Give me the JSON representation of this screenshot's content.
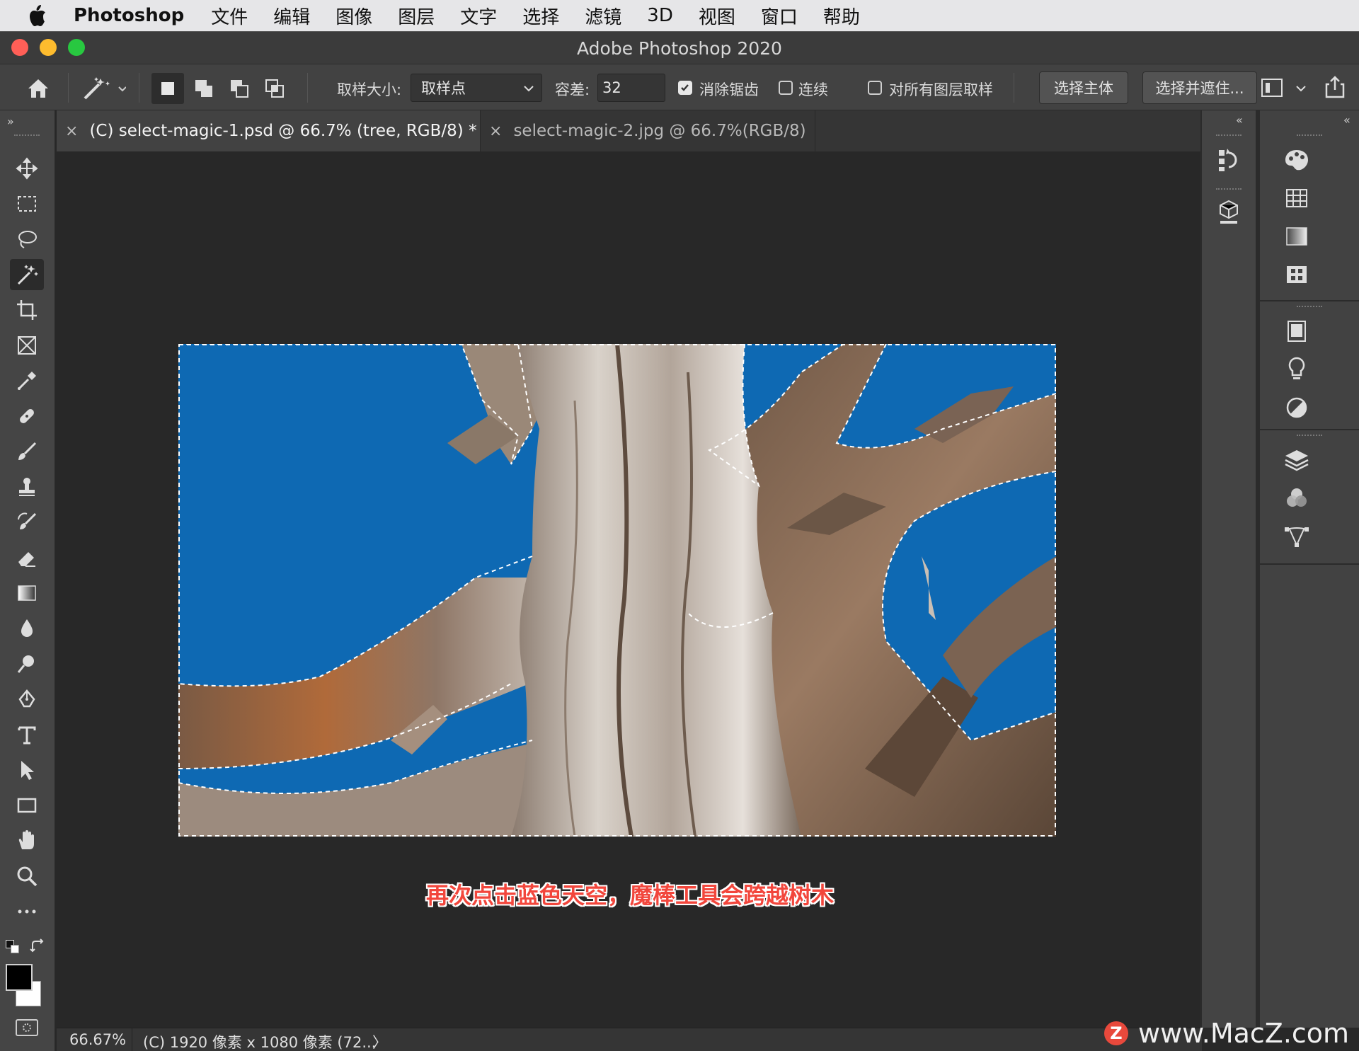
{
  "menubar": {
    "app_name": "Photoshop",
    "items": [
      "文件",
      "编辑",
      "图像",
      "图层",
      "文字",
      "选择",
      "滤镜",
      "3D",
      "视图",
      "窗口",
      "帮助"
    ]
  },
  "window": {
    "title": "Adobe Photoshop 2020"
  },
  "options_bar": {
    "sample_size_label": "取样大小:",
    "sample_size_value": "取样点",
    "tolerance_label": "容差:",
    "tolerance_value": "32",
    "anti_alias_label": "消除锯齿",
    "anti_alias_checked": true,
    "contiguous_label": "连续",
    "contiguous_checked": false,
    "sample_all_layers_label": "对所有图层取样",
    "sample_all_layers_checked": false,
    "select_subject_label": "选择主体",
    "select_and_mask_label": "选择并遮住..."
  },
  "tabs": [
    {
      "label": "(C) select-magic-1.psd @ 66.7% (tree, RGB/8) *",
      "active": true
    },
    {
      "label": "select-magic-2.jpg @ 66.7%(RGB/8)",
      "active": false
    }
  ],
  "tools": [
    "move-icon",
    "marquee-icon",
    "lasso-icon",
    "magic-wand-icon",
    "crop-icon",
    "frame-icon",
    "eyedropper-icon",
    "healing-brush-icon",
    "brush-icon",
    "clone-stamp-icon",
    "history-brush-icon",
    "eraser-icon",
    "gradient-icon",
    "blur-icon",
    "dodge-icon",
    "pen-icon",
    "type-icon",
    "path-selection-icon",
    "rectangle-icon",
    "hand-icon",
    "zoom-icon",
    "more-tools-icon"
  ],
  "active_tool": "magic-wand-icon",
  "canvas": {
    "caption": "再次点击蓝色天空，魔棒工具会跨越树木",
    "sky_color": "#0e69b3"
  },
  "statusbar": {
    "zoom": "66.67%",
    "doc_info": "(C) 1920 像素 x 1080 像素 (72...",
    "arrow": "〉"
  },
  "watermark": {
    "badge": "Z",
    "text": "www.MacZ.com"
  },
  "colors": {
    "foreground": "#000000",
    "background": "#ffffff",
    "selection_close": "#ff5f57",
    "selection_min": "#febc2e",
    "selection_max": "#28c840"
  }
}
